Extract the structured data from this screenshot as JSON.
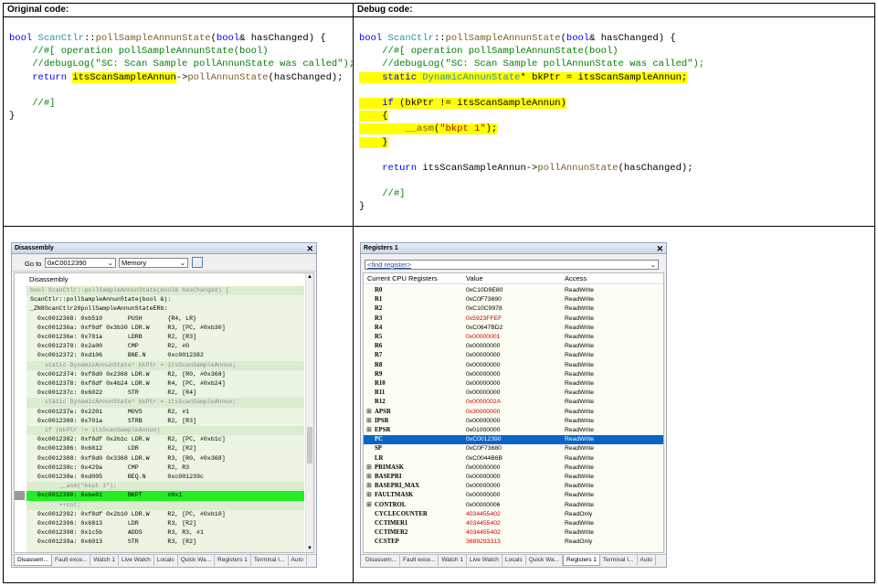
{
  "headers": {
    "original": "Original code:",
    "debug": "Debug code:"
  },
  "original_code": [
    "bool ScanCtlr::pollSampleAnnunState(bool& hasChanged) {",
    "    //#[ operation pollSampleAnnunState(bool)",
    "    //debugLog(\"SC: Scan Sample pollAnnunState was called\");",
    "    return itsScanSampleAnnun->pollAnnunState(hasChanged);",
    "",
    "    //#]",
    "}"
  ],
  "debug_code": [
    "bool ScanCtlr::pollSampleAnnunState(bool& hasChanged) {",
    "    //#[ operation pollSampleAnnunState(bool)",
    "    //debugLog(\"SC: Scan Sample pollAnnunState was called\");",
    "    static DynamicAnnunState* bkPtr = itsScanSampleAnnun;",
    "",
    "    if (bkPtr != itsScanSampleAnnun)",
    "    {",
    "        __asm(\"bkpt 1\");",
    "    }",
    "",
    "    return itsScanSampleAnnun->pollAnnunState(hasChanged);",
    "",
    "    //#]",
    "}"
  ],
  "disassembly": {
    "title": "Disassembly",
    "goto_label": "Go to",
    "goto_value": "0xC0012390",
    "memory_value": "Memory",
    "pane_title": "Disassembly",
    "lines": [
      {
        "t": "bool ScanCtlr::pollSampleAnnunState(bool& hasChanged) {",
        "k": "src"
      },
      {
        "t": "ScanCtlr::pollSampleAnnunState(bool &):",
        "k": "lbl"
      },
      {
        "t": "_ZN8ScanCtlr20pollSampleAnnunStateERb:",
        "k": "lbl"
      },
      {
        "t": "  0xc0012368: 0xb510       PUSH       {R4, LR}",
        "k": "asm"
      },
      {
        "t": "  0xc001236a: 0xf8df 0x3b30 LDR.W     R3, [PC, #0xb30]",
        "k": "asm"
      },
      {
        "t": "  0xc001236e: 0x781a       LDRB       R2, [R3]",
        "k": "asm"
      },
      {
        "t": "  0xc0012370: 0x2a00       CMP        R2, #0",
        "k": "asm"
      },
      {
        "t": "  0xc0012372: 0xd106       BNE.N      0xc0012382",
        "k": "asm"
      },
      {
        "t": "    static DynamicAnnunState* bkPtr = itsScanSampleAnnun;",
        "k": "src"
      },
      {
        "t": "  0xc0012374: 0xf8d0 0x2368 LDR.W     R2, [R0, #0x368]",
        "k": "asm"
      },
      {
        "t": "  0xc0012378: 0xf8df 0x4b24 LDR.W     R4, [PC, #0xb24]",
        "k": "asm"
      },
      {
        "t": "  0xc001237c: 0x6022       STR        R2, [R4]",
        "k": "asm"
      },
      {
        "t": "    static DynamicAnnunState* bkPtr = itsScanSampleAnnun;",
        "k": "src"
      },
      {
        "t": "  0xc001237e: 0x2201       MOVS       R2, #1",
        "k": "asm"
      },
      {
        "t": "  0xc0012380: 0x701a       STRB       R2, [R3]",
        "k": "asm"
      },
      {
        "t": "    if (bkPtr != itsScanSampleAnnun)",
        "k": "src"
      },
      {
        "t": "  0xc0012382: 0xf8df 0x2b1c LDR.W     R2, [PC, #0xb1c]",
        "k": "asm"
      },
      {
        "t": "  0xc0012386: 0x6812       LDR        R2, [R2]",
        "k": "asm"
      },
      {
        "t": "  0xc0012388: 0xf8d0 0x3368 LDR.W     R3, [R0, #0x368]",
        "k": "asm"
      },
      {
        "t": "  0xc001238c: 0x429a       CMP        R2, R3",
        "k": "asm"
      },
      {
        "t": "  0xc001238e: 0xd005       BEQ.N      0xc001239c",
        "k": "asm"
      },
      {
        "t": "        __asm(\"bkpt 1\");",
        "k": "src"
      },
      {
        "t": "  0xc0012390: 0xbe01       BKPT       #0x1",
        "k": "cur"
      },
      {
        "t": "        ++cnt;",
        "k": "src"
      },
      {
        "t": "  0xc0012392: 0xf8df 0x2b10 LDR.W     R2, [PC, #0xb10]",
        "k": "asm"
      },
      {
        "t": "  0xc0012396: 0x6813       LDR        R3, [R2]",
        "k": "asm"
      },
      {
        "t": "  0xc0012398: 0x1c5b       ADDS       R3, R3, #1",
        "k": "asm"
      },
      {
        "t": "  0xc001239a: 0x6013       STR        R3, [R2]",
        "k": "asm"
      }
    ],
    "tabs": [
      "Disassem...",
      "Fault exce...",
      "Watch 1",
      "Live Watch",
      "Locals",
      "Quick Wa...",
      "Registers 1",
      "Terminal I...",
      "Auto"
    ],
    "active_tab": 0
  },
  "registers": {
    "title": "Registers 1",
    "find_placeholder": "<find register>",
    "col_name": "Current CPU Registers",
    "col_value": "Value",
    "col_access": "Access",
    "rows": [
      {
        "n": "R0",
        "v": "0xC10D9E80",
        "a": "ReadWrite",
        "red": false,
        "exp": false
      },
      {
        "n": "R1",
        "v": "0xC0F73690",
        "a": "ReadWrite",
        "red": false,
        "exp": false
      },
      {
        "n": "R2",
        "v": "0xC10C9978",
        "a": "ReadWrite",
        "red": false,
        "exp": false
      },
      {
        "n": "R3",
        "v": "0x5923FFEF",
        "a": "ReadWrite",
        "red": true,
        "exp": false
      },
      {
        "n": "R4",
        "v": "0xC0647BD2",
        "a": "ReadWrite",
        "red": false,
        "exp": false
      },
      {
        "n": "R5",
        "v": "0x00000001",
        "a": "ReadWrite",
        "red": true,
        "exp": false
      },
      {
        "n": "R6",
        "v": "0x00000000",
        "a": "ReadWrite",
        "red": false,
        "exp": false
      },
      {
        "n": "R7",
        "v": "0x00000000",
        "a": "ReadWrite",
        "red": false,
        "exp": false
      },
      {
        "n": "R8",
        "v": "0x00000000",
        "a": "ReadWrite",
        "red": false,
        "exp": false
      },
      {
        "n": "R9",
        "v": "0x00000000",
        "a": "ReadWrite",
        "red": false,
        "exp": false
      },
      {
        "n": "R10",
        "v": "0x00000000",
        "a": "ReadWrite",
        "red": false,
        "exp": false
      },
      {
        "n": "R11",
        "v": "0x00000000",
        "a": "ReadWrite",
        "red": false,
        "exp": false
      },
      {
        "n": "R12",
        "v": "0x0000002A",
        "a": "ReadWrite",
        "red": true,
        "exp": false
      },
      {
        "n": "APSR",
        "v": "0x30000000",
        "a": "ReadWrite",
        "red": true,
        "exp": true
      },
      {
        "n": "IPSR",
        "v": "0x00000000",
        "a": "ReadWrite",
        "red": false,
        "exp": true
      },
      {
        "n": "EPSR",
        "v": "0x01000000",
        "a": "ReadWrite",
        "red": false,
        "exp": true
      },
      {
        "n": "PC",
        "v": "0xC0012390",
        "a": "ReadWrite",
        "red": true,
        "exp": false,
        "sel": true
      },
      {
        "n": "SP",
        "v": "0xC0F73680",
        "a": "ReadWrite",
        "red": false,
        "exp": false
      },
      {
        "n": "LR",
        "v": "0xC0044B6B",
        "a": "ReadWrite",
        "red": false,
        "exp": false
      },
      {
        "n": "PRIMASK",
        "v": "0x00000000",
        "a": "ReadWrite",
        "red": false,
        "exp": true
      },
      {
        "n": "BASEPRI",
        "v": "0x00000000",
        "a": "ReadWrite",
        "red": false,
        "exp": true
      },
      {
        "n": "BASEPRI_MAX",
        "v": "0x00000000",
        "a": "ReadWrite",
        "red": false,
        "exp": true
      },
      {
        "n": "FAULTMASK",
        "v": "0x00000000",
        "a": "ReadWrite",
        "red": false,
        "exp": true
      },
      {
        "n": "CONTROL",
        "v": "0x00000006",
        "a": "ReadWrite",
        "red": false,
        "exp": true
      },
      {
        "n": "CYCLECOUNTER",
        "v": "4034455402",
        "a": "ReadOnly",
        "red": true,
        "exp": false
      },
      {
        "n": "CCTIMER1",
        "v": "4034455402",
        "a": "ReadWrite",
        "red": true,
        "exp": false
      },
      {
        "n": "CCTIMER2",
        "v": "4034455402",
        "a": "ReadWrite",
        "red": true,
        "exp": false
      },
      {
        "n": "CCSTEP",
        "v": "3689293313",
        "a": "ReadOnly",
        "red": true,
        "exp": false
      }
    ],
    "tabs": [
      "Disassem...",
      "Fault exce...",
      "Watch 1",
      "Live Watch",
      "Locals",
      "Quick Wa...",
      "Registers 1",
      "Terminal I...",
      "Auto"
    ],
    "active_tab": 6
  }
}
